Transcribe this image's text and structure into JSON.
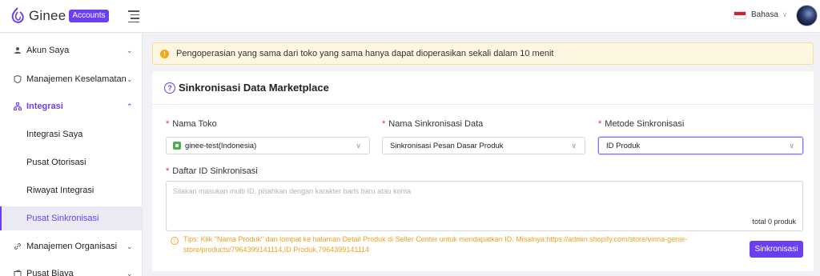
{
  "header": {
    "logo_text": "Ginee",
    "logo_badge": "Accounts",
    "language": "Bahasa"
  },
  "sidebar": {
    "items": [
      {
        "label": "Akun Saya",
        "icon": "user-icon"
      },
      {
        "label": "Manajemen Keselamatan",
        "icon": "shield-icon"
      },
      {
        "label": "Integrasi",
        "icon": "sitemap-icon",
        "open": true
      },
      {
        "label": "Manajemen Organisasi",
        "icon": "link-icon"
      },
      {
        "label": "Pusat Biaya",
        "icon": "wallet-icon"
      }
    ],
    "sub_items": [
      {
        "label": "Integrasi Saya"
      },
      {
        "label": "Pusat Otorisasi"
      },
      {
        "label": "Riwayat Integrasi"
      },
      {
        "label": "Pusat Sinkronisasi",
        "active": true
      }
    ]
  },
  "alert": {
    "text": "Pengoperasian yang sama dari toko yang sama hanya dapat dioperasikan sekali dalam 10 menit"
  },
  "card": {
    "title": "Sinkronisasi Data Marketplace",
    "fields": {
      "store": {
        "label": "Nama Toko",
        "value": "ginee-test(Indonesia)"
      },
      "sync_name": {
        "label": "Nama Sinkronisasi Data",
        "value": "Sinkronisasi Pesan Dasar Produk"
      },
      "method": {
        "label": "Metode Sinkronisasi",
        "value": "ID Produk"
      },
      "id_list": {
        "label": "Daftar ID Sinkronisasi",
        "placeholder": "Silakan masukan multi ID, pisahkan dengan karakter baris baru atau koma",
        "count": "total 0 produk"
      }
    },
    "tips": "Tips: Klik \"Nama Produk\" dan lompat ke halaman Detail Produk di Seller Center untuk mendapatkan ID. Misalnya:https://admin.shopify.com/store/vinna-genie-store/products/7964399141114,ID Produk,7964399141114",
    "sync_button": "Sinkronisasi"
  },
  "colors": {
    "brand": "#6b3ff0",
    "alert_bg": "#fdf6e0",
    "tips": "#f0a020",
    "required": "#e0312f"
  }
}
